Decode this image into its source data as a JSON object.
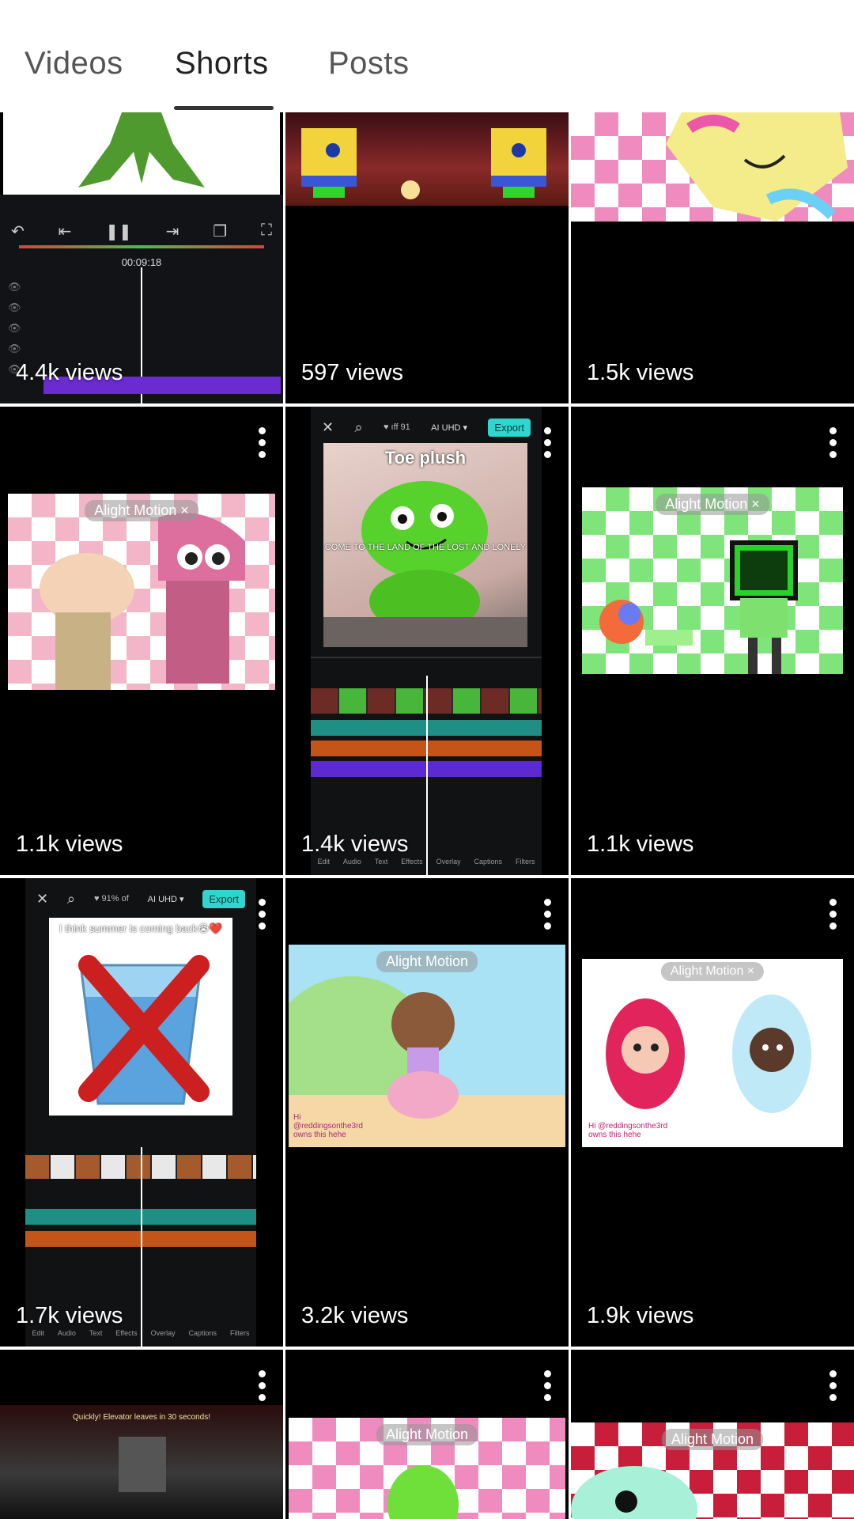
{
  "tabs": [
    {
      "label": "Videos",
      "active": false
    },
    {
      "label": "Shorts",
      "active": true
    },
    {
      "label": "Posts",
      "active": false
    }
  ],
  "shorts": [
    {
      "views": "4.4k views",
      "editor_time": "00:09:18"
    },
    {
      "views": "597 views"
    },
    {
      "views": "1.5k views"
    },
    {
      "views": "1.1k views",
      "watermark": "Alight Motion ×"
    },
    {
      "views": "1.4k views",
      "title": "Toe plush",
      "caption": "COME TO THE LAND OF THE LOST AND LONELY",
      "export_label": "Export",
      "quality": "AI UHD ▾",
      "credits": "♥ ıff  91"
    },
    {
      "views": "1.1k views",
      "watermark": "Alight Motion ×"
    },
    {
      "views": "1.7k views",
      "caption": "I think summer is coming back😭❤️",
      "export_label": "Export",
      "quality": "AI UHD ▾",
      "credits": "♥ 91% of"
    },
    {
      "views": "3.2k views",
      "watermark": "Alight Motion",
      "credit_text": "Hi @reddingsonthe3rd owns this hehe"
    },
    {
      "views": "1.9k views",
      "watermark": "Alight Motion ×",
      "credit_text": "Hi @reddingsonthe3rd owns this hehe"
    },
    {
      "views": "",
      "top_text": "Quickly! Elevator leaves in 30 seconds!"
    },
    {
      "views": "",
      "watermark": "Alight Motion"
    },
    {
      "views": "",
      "watermark": "Alight Motion"
    }
  ],
  "colors": {
    "tab_active": "#222222",
    "tab_inactive": "#555555",
    "export": "#2fd6d0",
    "tile_bg": "#000000"
  },
  "icons": [
    "more-vert-icon",
    "close-icon",
    "search-icon",
    "play-pause-icon",
    "undo-icon",
    "fullscreen-icon"
  ]
}
